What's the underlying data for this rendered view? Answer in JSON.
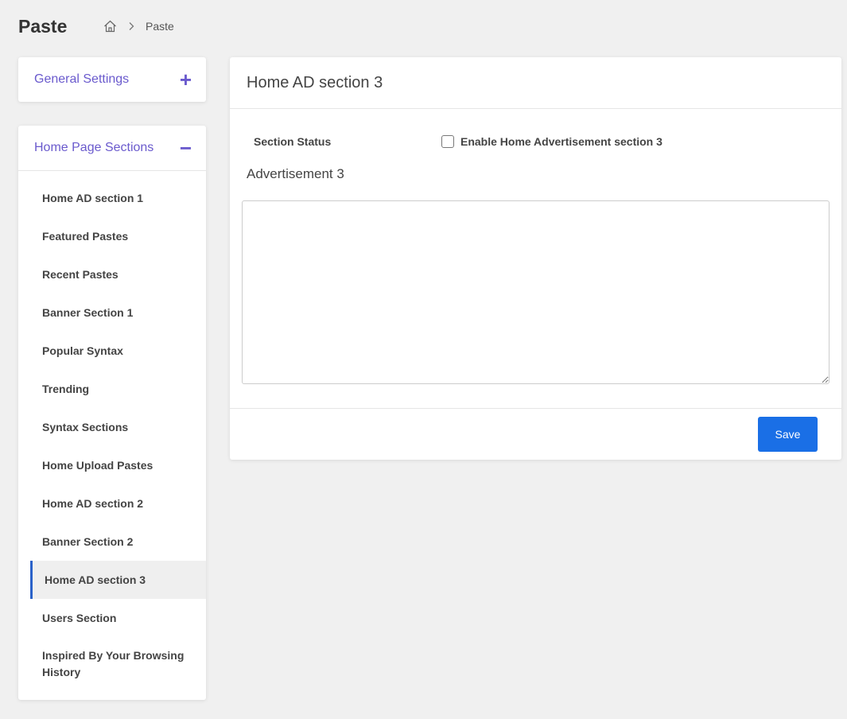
{
  "header": {
    "title": "Paste",
    "breadcrumb": {
      "home_icon": "home-icon",
      "separator_icon": "chevron-right-icon",
      "current": "Paste"
    }
  },
  "sidebar": {
    "general_settings": {
      "label": "General Settings",
      "toggle": "+"
    },
    "home_page_sections": {
      "label": "Home Page Sections",
      "toggle": "−",
      "items": [
        {
          "label": "Home AD section 1"
        },
        {
          "label": "Featured Pastes"
        },
        {
          "label": "Recent Pastes"
        },
        {
          "label": "Banner Section 1"
        },
        {
          "label": "Popular Syntax"
        },
        {
          "label": "Trending"
        },
        {
          "label": "Syntax Sections"
        },
        {
          "label": "Home Upload Pastes"
        },
        {
          "label": "Home AD section 2"
        },
        {
          "label": "Banner Section 2"
        },
        {
          "label": "Home AD section 3",
          "active": true
        },
        {
          "label": "Users Section"
        },
        {
          "label": "Inspired By Your Browsing History"
        }
      ]
    }
  },
  "main": {
    "title": "Home AD section 3",
    "section_status_label": "Section Status",
    "enable_checkbox_label": "Enable Home Advertisement section 3",
    "enable_checked": false,
    "advertisement_label": "Advertisement 3",
    "advertisement_value": "",
    "save_label": "Save"
  },
  "colors": {
    "accent": "#6a5acd",
    "primary_button": "#1a6fe6",
    "active_indicator": "#2a62c9",
    "background": "#f0f0f0"
  }
}
